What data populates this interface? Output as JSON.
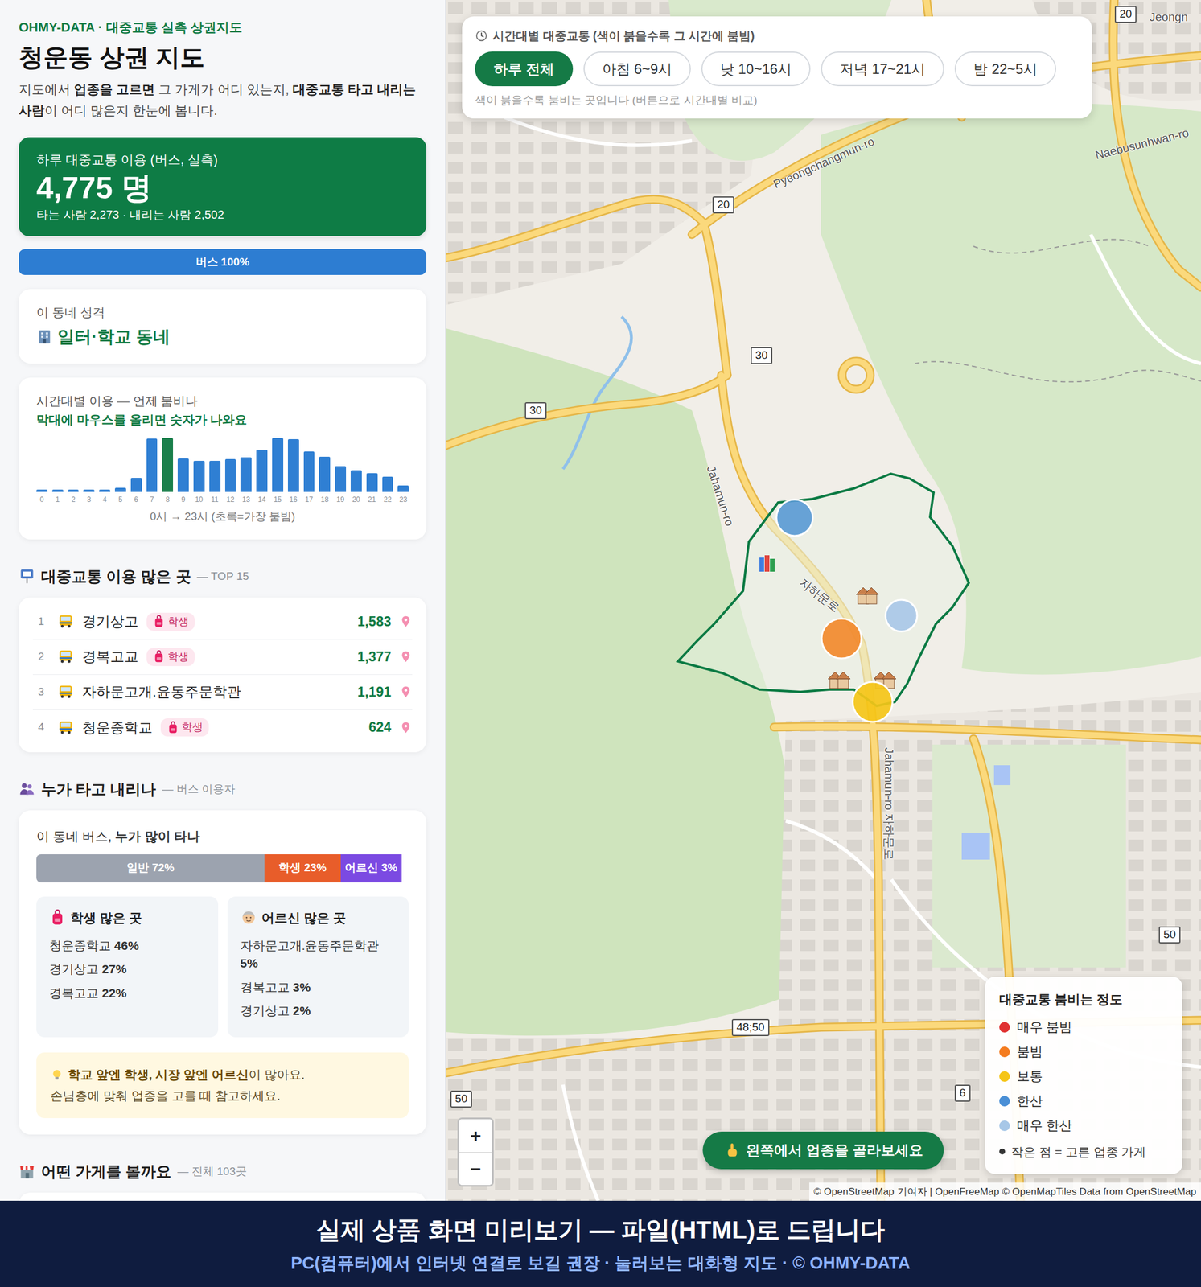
{
  "brand": "OHMY-DATA · 대중교통 실측 상권지도",
  "title": "청운동 상권 지도",
  "intro": [
    {
      "text": "지도에서 ",
      "bold": false
    },
    {
      "text": "업종을 고르면",
      "bold": true
    },
    {
      "text": " 그 가게가 어디 있는지, ",
      "bold": false
    },
    {
      "text": "대중교통 타고 내리는 사람",
      "bold": true
    },
    {
      "text": "이 어디 많은지 한눈에 봅니다.",
      "bold": false
    }
  ],
  "total": {
    "label": "하루 대중교통 이용 (버스, 실측)",
    "value": "4,775 명",
    "detail": "타는 사람 2,273 · 내리는 사람 2,502"
  },
  "mode_bar": [
    {
      "label": "버스 100%",
      "level": 1,
      "color": "#2d7dd2"
    }
  ],
  "character": {
    "label": "이 동네 성격",
    "value": "일터·학교 동네"
  },
  "hourly": {
    "title": "시간대별 이용 — 언제 붐비나",
    "hint": "막대에 마우스를 올리면 숫자가 나와요",
    "hours": [
      "0",
      "1",
      "2",
      "3",
      "4",
      "5",
      "6",
      "7",
      "8",
      "9",
      "10",
      "11",
      "12",
      "13",
      "14",
      "15",
      "16",
      "17",
      "18",
      "19",
      "20",
      "21",
      "22",
      "23"
    ],
    "values": [
      20,
      20,
      20,
      20,
      20,
      33,
      111,
      415,
      420,
      261,
      242,
      242,
      255,
      268,
      327,
      418,
      411,
      314,
      274,
      202,
      170,
      144,
      118,
      52
    ],
    "peak_index": 8,
    "caption": "0시 → 23시 (초록=가장 붐빔)"
  },
  "top_stops": {
    "title": "대중교통 이용 많은 곳",
    "note": "— TOP 15",
    "rows": [
      {
        "rank": "1",
        "name": "경기상고",
        "badge": "학생",
        "count": "1,583"
      },
      {
        "rank": "2",
        "name": "경복고교",
        "badge": "학생",
        "count": "1,377"
      },
      {
        "rank": "3",
        "name": "자하문고개.윤동주문학관",
        "count": "1,191"
      },
      {
        "rank": "4",
        "name": "청운중학교",
        "badge": "학생",
        "count": "624"
      }
    ]
  },
  "riders": {
    "title": "누가 타고 내리나",
    "note": "— 버스 이용자",
    "lead": [
      {
        "text": "이 동네 버스, ",
        "bold": false
      },
      {
        "text": "누가 많이 타나",
        "bold": true
      }
    ],
    "segments": [
      {
        "label": "일반 72%",
        "level": 0.72,
        "color": "#9ca3af"
      },
      {
        "label": "학생 23%",
        "level": 0.23,
        "color": "#e85d2a"
      },
      {
        "label": "어르신 3%",
        "level": 0.03,
        "color": "#7b4ae2"
      }
    ],
    "groups": [
      {
        "title": "학생 많은 곳",
        "kind": "student",
        "items": [
          {
            "name": "청운중학교",
            "share": "46%"
          },
          {
            "name": "경기상고",
            "share": "27%"
          },
          {
            "name": "경복고교",
            "share": "22%"
          }
        ]
      },
      {
        "title": "어르신 많은 곳",
        "kind": "elder",
        "items": [
          {
            "name": "자하문고개.윤동주문학관",
            "share": "5%"
          },
          {
            "name": "경복고교",
            "share": "3%"
          },
          {
            "name": "경기상고",
            "share": "2%"
          }
        ]
      }
    ],
    "tip": [
      [
        {
          "text": "학교 앞엔 학생, 시장 앞엔 어르신",
          "bold": true
        },
        {
          "text": "이 많아요.",
          "bold": false
        }
      ],
      [
        {
          "text": "손님층에 맞춰 업종을 고를 때 참고하세요.",
          "bold": false
        }
      ]
    ]
  },
  "shops": {
    "title": "어떤 가게를 볼까요",
    "note": "— 전체 103곳"
  },
  "map": {
    "time_filter": {
      "title": "시간대별 대중교통 (색이 붉을수록 그 시간에 붐빔)",
      "buttons": [
        {
          "label": "하루 전체",
          "selected": true
        },
        {
          "label": "아침 6~9시",
          "selected": false
        },
        {
          "label": "낮 10~16시",
          "selected": false
        },
        {
          "label": "저녁 17~21시",
          "selected": false
        },
        {
          "label": "밤 22~5시",
          "selected": false
        }
      ],
      "hint": "색이 붉을수록 붐비는 곳입니다 (버튼으로 시간대별 비교)"
    },
    "labels": [
      {
        "text": "20",
        "kind": "shield"
      },
      {
        "text": "Jeongn",
        "kind": "name"
      },
      {
        "text": "Pyeongchangmun-ro",
        "kind": "name"
      },
      {
        "text": "Naebusunhwan-ro",
        "kind": "name"
      },
      {
        "text": "20",
        "kind": "shield"
      },
      {
        "text": "30",
        "kind": "shield"
      },
      {
        "text": "30",
        "kind": "shield"
      },
      {
        "text": "Jahamun-ro",
        "kind": "name"
      },
      {
        "text": "자하문로",
        "kind": "name"
      },
      {
        "text": "Jahamun-ro 자하문로",
        "kind": "name"
      },
      {
        "text": "48;50",
        "kind": "shield"
      },
      {
        "text": "6",
        "kind": "shield"
      },
      {
        "text": "50",
        "kind": "shield"
      },
      {
        "text": "50",
        "kind": "shield"
      }
    ],
    "stops": [
      {
        "color": "#5b9bd5"
      },
      {
        "color": "#a9c8e8"
      },
      {
        "color": "#f28a2e"
      },
      {
        "color": "#f5c518"
      }
    ],
    "zoom": [
      "+",
      "−"
    ],
    "prompt": "왼쪽에서 업종을 골라보세요",
    "legend": {
      "title": "대중교통 붐비는 정도",
      "items": [
        {
          "label": "매우 붐빔",
          "color": "#e03131"
        },
        {
          "label": "붐빔",
          "color": "#f47c20"
        },
        {
          "label": "보통",
          "color": "#f5c518"
        },
        {
          "label": "한산",
          "color": "#4a8fd6"
        },
        {
          "label": "매우 한산",
          "color": "#a7c7e7"
        }
      ],
      "note": "작은 점 = 고른 업종 가게"
    },
    "attribution": "© OpenStreetMap 기여자 | OpenFreeMap © OpenMapTiles Data from OpenStreetMap"
  },
  "footer": {
    "title": "실제 상품 화면 미리보기 — 파일(HTML)로 드립니다",
    "subtitle": "PC(컴퓨터)에서 인터넷 연결로 보길 권장 · 눌러보는 대화형 지도 · © OHMY-DATA"
  }
}
